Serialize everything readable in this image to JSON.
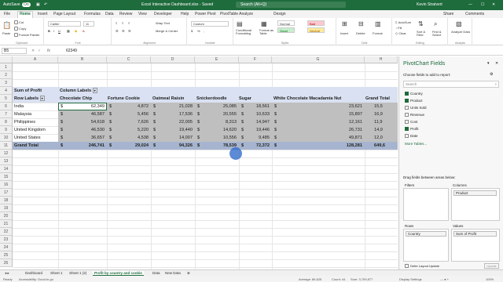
{
  "titlebar": {
    "autosave": "AutoSave",
    "autosave_state": "On",
    "file": "Excel Interactive Dashboard.xlsx - Saved",
    "search": "Search (Alt+Q)",
    "user": "Kevin Stratvert"
  },
  "tabs": [
    "File",
    "Home",
    "Insert",
    "Page Layout",
    "Formulas",
    "Data",
    "Review",
    "View",
    "Developer",
    "Help",
    "Power Pivot",
    "PivotTable Analyze",
    "Design"
  ],
  "tabs_right": {
    "share": "Share",
    "comments": "Comments"
  },
  "ribbon": {
    "clipboard": {
      "label": "Clipboard",
      "paste": "Paste",
      "cut": "Cut",
      "copy": "Copy",
      "format_painter": "Format Painter"
    },
    "font": {
      "label": "Font",
      "name": "Calibri",
      "size": "11"
    },
    "alignment": {
      "label": "Alignment",
      "wrap": "Wrap Text",
      "merge": "Merge & Center"
    },
    "number": {
      "label": "Number",
      "format": "Custom"
    },
    "styles": {
      "label": "Styles",
      "conditional": "Conditional Formatting",
      "format_table": "Format as Table",
      "normal": "Normal",
      "bad": "Bad",
      "good": "Good",
      "neutral": "Neutral"
    },
    "cells": {
      "label": "Cells",
      "insert": "Insert",
      "delete": "Delete",
      "format": "Format"
    },
    "editing": {
      "label": "Editing",
      "autosum": "AutoSum",
      "fill": "Fill",
      "clear": "Clear",
      "sort": "Sort & Filter",
      "find": "Find & Select"
    },
    "analysis": {
      "label": "Analysis",
      "analyze": "Analyze Data"
    }
  },
  "formula": {
    "namebox": "B5",
    "fx": "fx",
    "value": "62349"
  },
  "grid": {
    "columns": [
      "A",
      "B",
      "C",
      "D",
      "E",
      "F",
      "G",
      "H"
    ],
    "rows": [
      "1",
      "2",
      "3",
      "4",
      "5",
      "6",
      "7",
      "8",
      "9",
      "10",
      "11",
      "12",
      "13",
      "14",
      "15",
      "16",
      "17",
      "18",
      "19",
      "20",
      "21",
      "22",
      "23",
      "24",
      "25",
      "26"
    ],
    "pivot_label": "Sum of Profit",
    "col_labels": "Column Labels",
    "row_labels": "Row Labels",
    "headers": [
      "Chocolate Chip",
      "Fortune Cookie",
      "Oatmeal Raisin",
      "Snickerdoodle",
      "Sugar",
      "White Chocolate Macadamia Nut",
      "Grand Total"
    ],
    "data": [
      {
        "country": "India",
        "values": [
          "62,349",
          "4,872",
          "21,028",
          "25,085",
          "18,561",
          "23,621",
          "15,5"
        ]
      },
      {
        "country": "Malaysia",
        "values": [
          "46,587",
          "5,456",
          "17,536",
          "20,555",
          "10,633",
          "15,897",
          "16,9"
        ]
      },
      {
        "country": "Philippines",
        "values": [
          "54,618",
          "7,626",
          "22,005",
          "8,313",
          "14,947",
          "12,161",
          "11,9"
        ]
      },
      {
        "country": "United Kingdom",
        "values": [
          "46,530",
          "5,220",
          "19,440",
          "14,620",
          "19,446",
          "26,731",
          "14,9"
        ]
      },
      {
        "country": "United States",
        "values": [
          "36,657",
          "4,538",
          "14,007",
          "10,556",
          "9,485",
          "49,871",
          "12,0"
        ]
      }
    ],
    "total": {
      "label": "Grand Total",
      "values": [
        "246,741",
        "29,024",
        "94,326",
        "78,539",
        "72,372",
        "128,281",
        "649,6"
      ]
    },
    "currency": "$"
  },
  "sheets": [
    "Dashboard",
    "Sheet 1",
    "Sheet 1 (2)",
    "Profit by country and cookie",
    "Data",
    "New Data"
  ],
  "status": {
    "ready": "Ready",
    "accessibility": "Accessibility: Good to go",
    "average": "Average: 86,625",
    "count": "Count: 44",
    "sum": "Sum: 3,709,877",
    "display": "Display Settings",
    "zoom": "100%"
  },
  "pane": {
    "title": "PivotChart Fields",
    "subtitle": "Choose fields to add to report:",
    "search": "Search",
    "fields": [
      {
        "name": "Country",
        "checked": true
      },
      {
        "name": "Product",
        "checked": true
      },
      {
        "name": "Units Sold",
        "checked": false
      },
      {
        "name": "Revenue",
        "checked": false
      },
      {
        "name": "Cost",
        "checked": false
      },
      {
        "name": "Profit",
        "checked": true
      },
      {
        "name": "Date",
        "checked": false
      }
    ],
    "more": "More Tables...",
    "drag": "Drag fields between areas below:",
    "filters": "Filters",
    "columns": "Columns",
    "rows": "Rows",
    "values": "Values",
    "col_field": "Product",
    "row_field": "Country",
    "val_field": "Sum of Profit",
    "defer": "Defer Layout Update",
    "update": "Update"
  }
}
